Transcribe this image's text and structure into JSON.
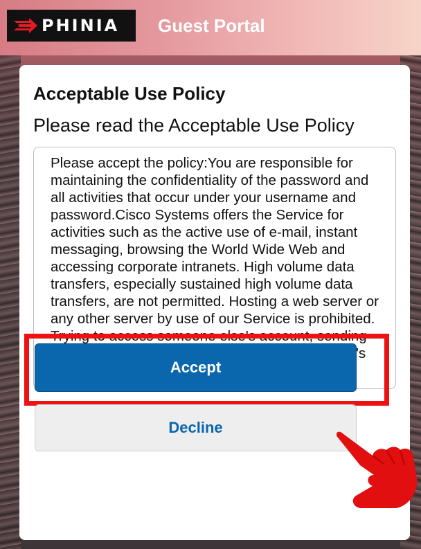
{
  "header": {
    "logo_text": "PHINIA",
    "portal_title": "Guest Portal"
  },
  "card": {
    "title": "Acceptable Use Policy",
    "subtitle": "Please read the Acceptable Use Policy",
    "policy_text": "Please accept the policy:You are responsible for maintaining the confidentiality of the password and all activities that occur under your username and password.Cisco Systems offers the Service for activities such as the active use of e-mail, instant messaging, browsing the World Wide Web and accessing corporate intranets. High volume data transfers, especially sustained high volume data transfers, are not permitted. Hosting a web server or any other server by use of our Service is prohibited. Trying to access someone else's account, sending unsolicited bulk e-mail, collection of other people's personal"
  },
  "buttons": {
    "accept_label": "Accept",
    "decline_label": "Decline"
  },
  "colors": {
    "accent": "#0a66ad",
    "highlight": "#e11111",
    "logo_red": "#e31b23"
  },
  "icons": {
    "logo_mark": "phinia-arrow-logo-icon",
    "pointer": "pointing-hand-icon"
  }
}
